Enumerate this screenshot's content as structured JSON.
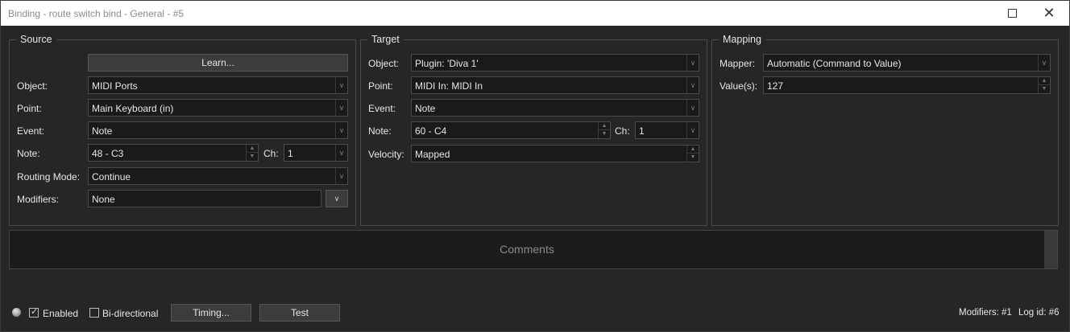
{
  "window": {
    "title": "Binding - route switch bind - General - #5",
    "maximize_icon": "maximize-icon",
    "close_icon": "close-icon",
    "close_glyph": "✕"
  },
  "source": {
    "legend": "Source",
    "learn_label": "Learn...",
    "object_label": "Object:",
    "object_value": "MIDI Ports",
    "point_label": "Point:",
    "point_value": "Main Keyboard (in)",
    "event_label": "Event:",
    "event_value": "Note",
    "note_label": "Note:",
    "note_value": "48 - C3",
    "ch_label": "Ch:",
    "ch_value": "1",
    "routing_label": "Routing Mode:",
    "routing_value": "Continue",
    "modifiers_label": "Modifiers:",
    "modifiers_value": "None"
  },
  "target": {
    "legend": "Target",
    "object_label": "Object:",
    "object_value": "Plugin: 'Diva 1'",
    "point_label": "Point:",
    "point_value": "MIDI In: MIDI In",
    "event_label": "Event:",
    "event_value": "Note",
    "note_label": "Note:",
    "note_value": "60 - C4",
    "ch_label": "Ch:",
    "ch_value": "1",
    "velocity_label": "Velocity:",
    "velocity_value": "Mapped"
  },
  "mapping": {
    "legend": "Mapping",
    "mapper_label": "Mapper:",
    "mapper_value": "Automatic (Command to Value)",
    "values_label": "Value(s):",
    "values_value": "127"
  },
  "comments": {
    "placeholder": "Comments"
  },
  "footer": {
    "enabled_label": "Enabled",
    "enabled_checked": true,
    "bidirectional_label": "Bi-directional",
    "bidirectional_checked": false,
    "timing_label": "Timing...",
    "test_label": "Test",
    "modifiers_status": "Modifiers: #1",
    "log_status": "Log id: #6"
  }
}
